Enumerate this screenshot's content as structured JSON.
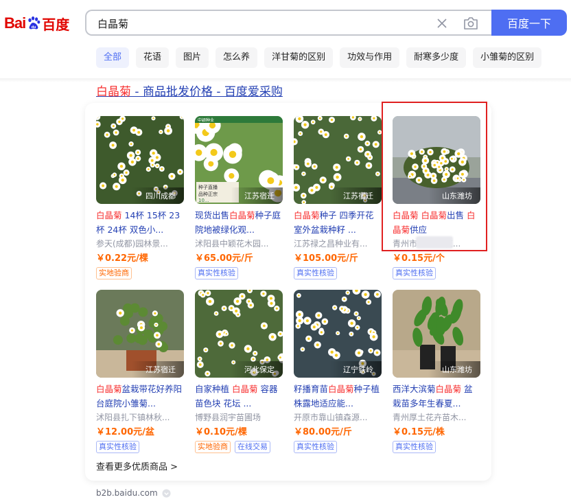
{
  "logo": {
    "bai": "Bai",
    "du": "百度"
  },
  "search": {
    "query": "白晶菊",
    "button": "百度一下"
  },
  "tabs": [
    "全部",
    "花语",
    "图片",
    "怎么养",
    "洋甘菊的区别",
    "功效与作用",
    "耐寒多少度",
    "小雏菊的区别"
  ],
  "result": {
    "title_hl": "白晶菊",
    "title_rest": " - 商品批发价格 - 百度爱采购"
  },
  "products": [
    {
      "location": "四川成都",
      "name": [
        [
          "白晶菊",
          1
        ],
        [
          " 14杯 15杯 23杯 24杯 双色小...",
          0
        ]
      ],
      "shop": "参天(成都)园林景...",
      "price": "￥0.22元/棵",
      "tags": [
        [
          "实地验商",
          "orange"
        ]
      ],
      "img": "a"
    },
    {
      "location": "江苏宿迁",
      "name": [
        [
          "现货出售",
          0
        ],
        [
          "白晶菊",
          1
        ],
        [
          "种子庭院地被绿化观...",
          0
        ]
      ],
      "shop": "沭阳县中颖花木园...",
      "price": "￥65.00元/斤",
      "tags": [
        [
          "真实性核验",
          "blue"
        ]
      ],
      "img": "b"
    },
    {
      "location": "江苏宿迁",
      "name": [
        [
          "白晶菊",
          1
        ],
        [
          "种子 四季开花室外盆栽种籽 ...",
          0
        ]
      ],
      "shop": "江苏禄之昌种业有...",
      "price": "￥105.00元/斤",
      "tags": [
        [
          "真实性核验",
          "blue"
        ]
      ],
      "img": "c"
    },
    {
      "location": "山东潍坊",
      "name": [
        [
          "白晶菊",
          1
        ],
        [
          " ",
          0
        ],
        [
          "白晶菊",
          1
        ],
        [
          "出售 ",
          0
        ],
        [
          "白晶菊",
          1
        ],
        [
          "供应",
          0
        ]
      ],
      "shop": "青州市",
      "shop_tail": "花...",
      "price": "￥0.15元/个",
      "tags": [
        [
          "真实性核验",
          "blue"
        ]
      ],
      "img": "d"
    },
    {
      "location": "江苏宿迁",
      "name": [
        [
          "白晶菊",
          1
        ],
        [
          "盆栽带花好养阳台庭院小雏菊...",
          0
        ]
      ],
      "shop": "沭阳县扎下镇林秋...",
      "price": "￥12.00元/盆",
      "tags": [
        [
          "真实性核验",
          "blue"
        ]
      ],
      "img": "e"
    },
    {
      "location": "河北保定",
      "name": [
        [
          "自家种植 ",
          0
        ],
        [
          "白晶菊",
          1
        ],
        [
          " 容器苗色块 花坛 ...",
          0
        ]
      ],
      "shop": "博野县润宇苗圃场",
      "price": "￥0.10元/棵",
      "tags": [
        [
          "实地验商",
          "orange"
        ],
        [
          "在线交易",
          "blue"
        ]
      ],
      "img": "f"
    },
    {
      "location": "辽宁铁岭",
      "name": [
        [
          "籽播育苗",
          0
        ],
        [
          "白晶菊",
          1
        ],
        [
          "种子植株露地适应能...",
          0
        ]
      ],
      "shop": "开原市靠山镇森源...",
      "price": "￥80.00元/斤",
      "tags": [
        [
          "真实性核验",
          "blue"
        ]
      ],
      "img": "g"
    },
    {
      "location": "山东潍坊",
      "name": [
        [
          "西洋大滨菊",
          0
        ],
        [
          "白晶菊",
          1
        ],
        [
          " 盆栽苗多年生春夏...",
          0
        ]
      ],
      "shop": "青州厚土花卉苗木...",
      "price": "￥0.15元/株",
      "tags": [
        [
          "真实性核验",
          "blue"
        ]
      ],
      "img": "h"
    }
  ],
  "seed_pack_text": [
    "中颖种业",
    "种子直播",
    "品种正宗",
    "10..."
  ],
  "more": "查看更多优质商品 >",
  "source": "b2b.baidu.com",
  "colors": {
    "accent": "#4e6ef2",
    "link": "#2440b3",
    "highlight": "#f73131",
    "price": "#ff6600",
    "box": "#e02020"
  }
}
